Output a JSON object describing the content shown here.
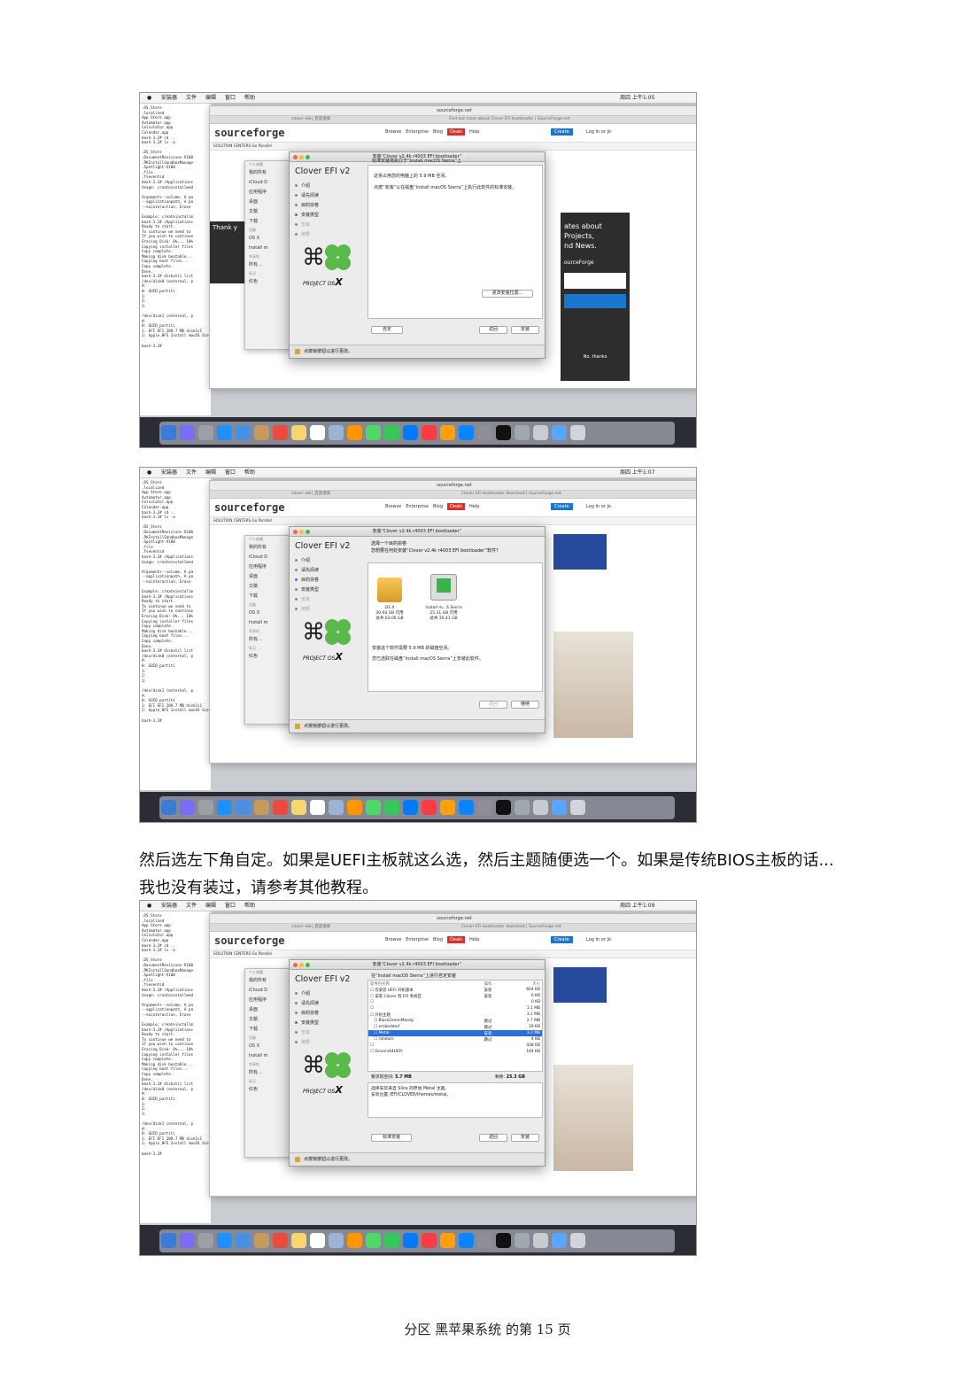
{
  "menubar": {
    "items": [
      "安装器",
      "文件",
      "编辑",
      "窗口",
      "帮助"
    ],
    "clock_1": "周四 上午1:05",
    "clock_2": "周四 上午1:07",
    "clock_3": "周四 上午1:09"
  },
  "safari": {
    "url": "sourceforge.net",
    "tab_left": "clover wiki_百度搜索",
    "tab_right_1": "Find out more about Clover EFI bootloader | SourceForge.net",
    "tab_right_2": "Clover EFI bootloader download | SourceForge.net",
    "logo": "sourceforge",
    "search_placeholder": "Search",
    "nav": [
      "Browse",
      "Enterprise",
      "Blog",
      "Deals",
      "Help"
    ],
    "create": "Create",
    "login": "Log In or Jo",
    "solutions": "SOLUTION CENTERS   Go Parallel",
    "thank_you": "Thank y",
    "promo": [
      "ates about",
      "Projects,",
      "nd News."
    ],
    "sourceforge_side": "ourceForge",
    "no_thanks": "No, thanks"
  },
  "terminal": {
    "lines": [
      ".DS_Store",
      ".localized",
      "App Store.app",
      "Automator.app",
      "Calculator.app",
      "Calendar.app",
      "bash-3.2# cd ..",
      "bash-3.2# ls -a",
      "",
      ".DS_Store",
      ".DocumentRevisions-V100",
      ".PKInstallSandboxManage",
      ".Spotlight-V100",
      ".file",
      ".fseventsd",
      "bash-3.2# /Applications",
      "Usage: createinstallmed",
      "",
      "Arguments--volume, A pa",
      "--applicationpath, A pa",
      "--nointeraction, Erase",
      "",
      "Example: createinstallm",
      "bash-3.2# /Applications",
      "Ready to start.",
      "To continue we need to",
      "If you wish to continue",
      "Erasing Disk: 0%... 10%",
      "Copying installer files",
      "Copy complete.",
      "Making disk bootable...",
      "Copying boot files...",
      "Copy complete.",
      "Done.",
      "bash-3.2# diskutil list",
      "/dev/disk0 (external, p",
      "   #:",
      "   0:      GUID_partiti",
      "   1:",
      "   2:",
      "   3:",
      "",
      "/dev/disk1 (external, p",
      "   #:",
      "   0:      GUID_partiti"
    ],
    "bottom": [
      "   1:     EFI EFI                 209.7 MB   disk1s1",
      "   2:     Apple_HFS Install macOS Sierra   30.4 GB   disk1s2",
      "",
      "bash-3.2# "
    ]
  },
  "finder": {
    "section_personal": "个人收藏",
    "items": [
      "我的所有",
      "iCloud D",
      "应用程序",
      "桌面",
      "文稿",
      "下载"
    ],
    "section_devices": "设备",
    "devices": [
      "OS X",
      "Install m"
    ],
    "section_shared": "共享的",
    "shared": [
      "所有..."
    ],
    "section_tags": "标记",
    "tags": [
      "红色",
      "橙色"
    ]
  },
  "installer": {
    "title": "安装“Clover v2.4k r4003 EFI bootloader”",
    "brand": "Clover EFI v2",
    "steps": [
      "介绍",
      "请先阅读",
      "目的宗卷",
      "安装类型",
      "安装",
      "摘要"
    ],
    "logo_text": "PROJECT OS",
    "logo_x": "X",
    "lock_text": "点按锁按钮以进行更改。",
    "back": "返回",
    "shot1": {
      "heading": "标准安装将执行于“Install macOS Sierra”上",
      "line1": "这将占用您的电脑上的 5.9 MB 空间。",
      "line2": "点按“安装”以在磁盘“Install macOS Sierra”上执行此软件的标准安装。",
      "change_location": "更改安装位置...",
      "customize": "自定",
      "install": "安装"
    },
    "shot2": {
      "heading": "选择一个目的宗卷",
      "subheading": "您想要在何处安装“Clover v2.4k r4003 EFI bootloader”软件？",
      "drive1_name": "OS X",
      "drive1_free": "30.44 GB 可用",
      "drive1_total": "总共 63.06 GB",
      "drive2_name": "Install m...S Sierra",
      "drive2_free": "25.31 GB 可用",
      "drive2_total": "总共 30.41 GB",
      "note1": "安装这个软件需要 5.9 MB 的磁盘空间。",
      "note2": "您已选取在磁盘“Install macOS Sierra”上安装此软件。",
      "continue": "继续"
    },
    "shot3": {
      "heading": "在“Install macOS Sierra”上进行自定安装",
      "col_name": "软件包名称",
      "col_action": "操作",
      "col_size": "大小",
      "rows": [
        {
          "name": "仅安装 UEFI 开机版本",
          "action": "安装",
          "size": "664 KB"
        },
        {
          "name": "安装 Clover 到 EFI 系统区",
          "action": "安装",
          "size": "0 KB"
        },
        {
          "name": "",
          "action": "",
          "size": "0 KB"
        },
        {
          "name": "",
          "action": "",
          "size": "1.1 MB"
        },
        {
          "name": "开机主题",
          "action": "",
          "size": "3.2 MB"
        },
        {
          "name": "BlackGreenMoody",
          "action": "跳过",
          "size": "2.7 MB"
        },
        {
          "name": "embedded",
          "action": "跳过",
          "size": "29 KB"
        },
        {
          "name": "Metal",
          "action": "安装",
          "size": "3.2 MB"
        },
        {
          "name": "random",
          "action": "跳过",
          "size": "4 KB"
        },
        {
          "name": "",
          "action": "",
          "size": "438 KB"
        },
        {
          "name": "Drivers64UEFI",
          "action": "",
          "size": "164 KB"
        }
      ],
      "space_required_label": "要求的空间:",
      "space_required": "5.7 MB",
      "space_left_label": "剩余:",
      "space_left": "25.3 GB",
      "desc1": "选择安装来自 Slice 的原始 Metal 主题。",
      "desc2": "安装位置 /EFI/CLOVER/themes/metal。",
      "standard_install": "标准安装",
      "install": "安装"
    }
  },
  "paragraph": "然后选左下角自定。如果是UEFI主板就这么选，然后主题随便选一个。如果是传统BIOS主板的话...我也没有装过，请参考其他教程。",
  "footer": "分区 黑苹果系统 的第 15 页",
  "colors": {
    "accent": "#2a7cd6",
    "clover_green": "#5bb94b",
    "deals_red": "#d9302c"
  }
}
